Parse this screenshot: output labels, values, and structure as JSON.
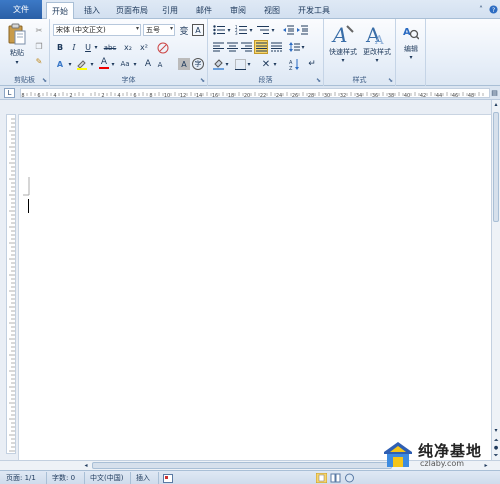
{
  "tabs": {
    "file": "文件",
    "items": [
      "开始",
      "插入",
      "页面布局",
      "引用",
      "邮件",
      "审阅",
      "视图",
      "开发工具"
    ],
    "active": "开始"
  },
  "ribbon": {
    "clipboard": {
      "label": "剪贴板",
      "paste": "粘贴"
    },
    "font": {
      "label": "字体",
      "font_name": "宋体 (中文正文)",
      "font_size": "五号",
      "bold": "B",
      "italic": "I",
      "underline": "U",
      "strike": "abc",
      "subscript": "x₂",
      "superscript": "x²",
      "font_color": "A",
      "case": "Aa",
      "grow": "A",
      "shrink": "A"
    },
    "paragraph": {
      "label": "段落"
    },
    "styles": {
      "label": "样式",
      "quick_styles": "快速样式",
      "change_styles": "更改样式"
    },
    "editing": {
      "label": "编辑"
    }
  },
  "ruler": {
    "h_ticks": [
      "8",
      "6",
      "4",
      "2",
      "",
      "2",
      "4",
      "6",
      "8",
      "10",
      "12",
      "14",
      "16",
      "18",
      "20",
      "22",
      "24",
      "26",
      "28",
      "30",
      "32",
      "34",
      "36",
      "38",
      "40",
      "42",
      "44",
      "46",
      "48"
    ]
  },
  "status": {
    "page": "页面: 1/1",
    "words": "字数: 0",
    "language": "中文(中国)",
    "mode": "插入"
  },
  "watermark": {
    "title": "纯净基地",
    "url": "czlaby.com"
  },
  "colors": {
    "file_tab": "#2a5fa6",
    "ribbon_bg": "#e6eef8",
    "accent": "#1e395b",
    "align_highlight": "#f8d66b"
  }
}
